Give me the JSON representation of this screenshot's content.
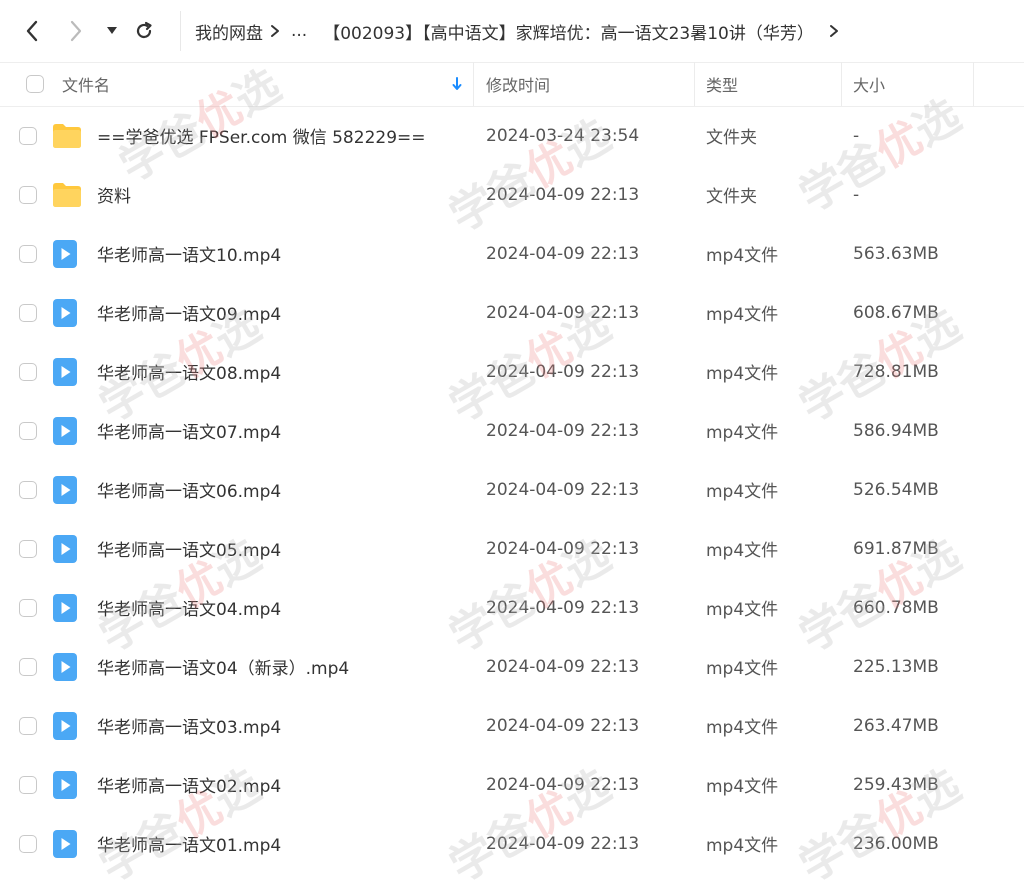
{
  "nav": {
    "back_icon": "chevron-left-icon",
    "forward_icon": "chevron-right-icon",
    "dropdown_icon": "caret-down-icon",
    "refresh_icon": "refresh-icon"
  },
  "breadcrumb": {
    "root": "我的网盘",
    "ellipsis": "...",
    "current": "【002093】【高中语文】家辉培优：高一语文23暑10讲（华芳）"
  },
  "columns": {
    "name": "文件名",
    "modified": "修改时间",
    "type": "类型",
    "size": "大小",
    "sort_icon": "sort-down-arrow-icon"
  },
  "colors": {
    "accent": "#1a8cff",
    "folder": "#ffc83d",
    "file_icon": "#4ba8f5"
  },
  "files": [
    {
      "name": "==学爸优选 FPSer.com 微信 582229==",
      "modified": "2024-03-24 23:54",
      "type": "文件夹",
      "size": "-",
      "kind": "folder"
    },
    {
      "name": "资料",
      "modified": "2024-04-09 22:13",
      "type": "文件夹",
      "size": "-",
      "kind": "folder"
    },
    {
      "name": "华老师高一语文10.mp4",
      "modified": "2024-04-09 22:13",
      "type": "mp4文件",
      "size": "563.63MB",
      "kind": "video"
    },
    {
      "name": "华老师高一语文09.mp4",
      "modified": "2024-04-09 22:13",
      "type": "mp4文件",
      "size": "608.67MB",
      "kind": "video"
    },
    {
      "name": "华老师高一语文08.mp4",
      "modified": "2024-04-09 22:13",
      "type": "mp4文件",
      "size": "728.81MB",
      "kind": "video"
    },
    {
      "name": "华老师高一语文07.mp4",
      "modified": "2024-04-09 22:13",
      "type": "mp4文件",
      "size": "586.94MB",
      "kind": "video"
    },
    {
      "name": "华老师高一语文06.mp4",
      "modified": "2024-04-09 22:13",
      "type": "mp4文件",
      "size": "526.54MB",
      "kind": "video"
    },
    {
      "name": "华老师高一语文05.mp4",
      "modified": "2024-04-09 22:13",
      "type": "mp4文件",
      "size": "691.87MB",
      "kind": "video"
    },
    {
      "name": "华老师高一语文04.mp4",
      "modified": "2024-04-09 22:13",
      "type": "mp4文件",
      "size": "660.78MB",
      "kind": "video"
    },
    {
      "name": "华老师高一语文04（新录）.mp4",
      "modified": "2024-04-09 22:13",
      "type": "mp4文件",
      "size": "225.13MB",
      "kind": "video"
    },
    {
      "name": "华老师高一语文03.mp4",
      "modified": "2024-04-09 22:13",
      "type": "mp4文件",
      "size": "263.47MB",
      "kind": "video"
    },
    {
      "name": "华老师高一语文02.mp4",
      "modified": "2024-04-09 22:13",
      "type": "mp4文件",
      "size": "259.43MB",
      "kind": "video"
    },
    {
      "name": "华老师高一语文01.mp4",
      "modified": "2024-04-09 22:13",
      "type": "mp4文件",
      "size": "236.00MB",
      "kind": "video"
    }
  ],
  "watermark": {
    "part1": "学爸",
    "part2": "优",
    "part3": "选"
  }
}
